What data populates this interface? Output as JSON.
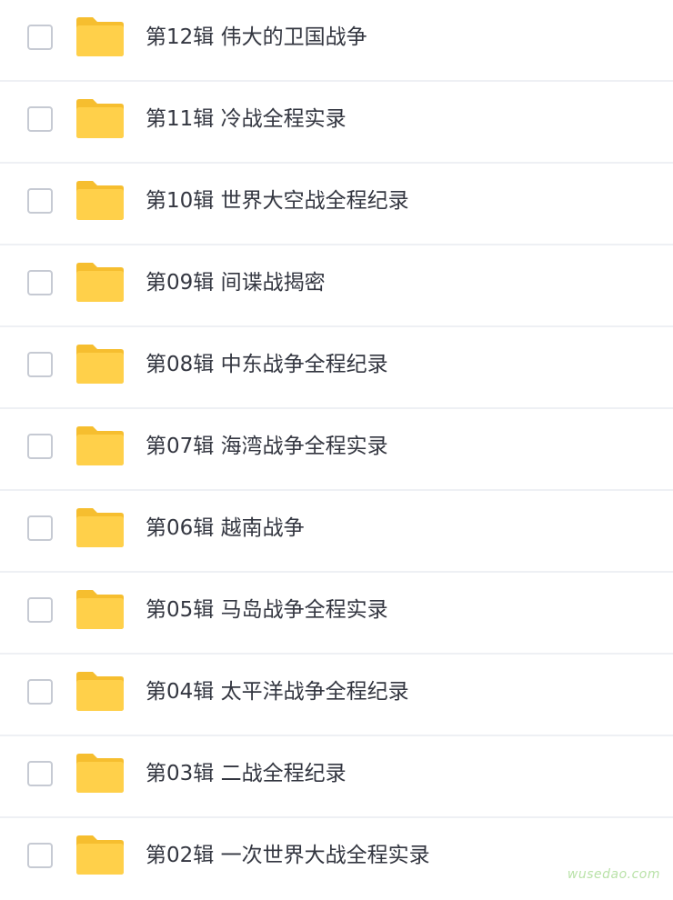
{
  "folder_color": "#FFD04A",
  "folder_tab_color": "#F6BE2F",
  "icon": "folder-icon",
  "items": [
    {
      "name": "第12辑 伟大的卫国战争"
    },
    {
      "name": "第11辑 冷战全程实录"
    },
    {
      "name": "第10辑 世界大空战全程纪录"
    },
    {
      "name": "第09辑 间谍战揭密"
    },
    {
      "name": "第08辑 中东战争全程纪录"
    },
    {
      "name": "第07辑 海湾战争全程实录"
    },
    {
      "name": "第06辑 越南战争"
    },
    {
      "name": "第05辑 马岛战争全程实录"
    },
    {
      "name": "第04辑 太平洋战争全程纪录"
    },
    {
      "name": "第03辑 二战全程纪录"
    },
    {
      "name": "第02辑 一次世界大战全程实录"
    }
  ],
  "watermark": "wusedao.com"
}
